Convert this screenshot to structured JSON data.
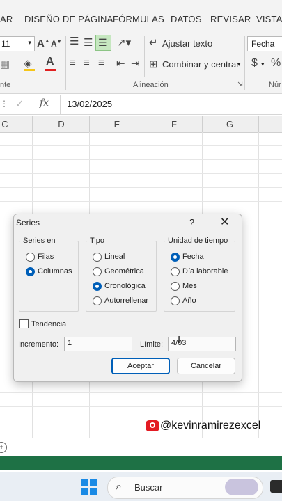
{
  "ribbon_tabs": [
    "AR",
    "DISEÑO DE PÁGINA",
    "FÓRMULAS",
    "DATOS",
    "REVISAR",
    "VISTA"
  ],
  "font_size": "11",
  "wrap_text": "Ajustar texto",
  "merge_center": "Combinar y centrar",
  "number_format": "Fecha",
  "group_font_label": "nte",
  "group_alignment_label": "Alineación",
  "group_number_label": "Núr",
  "formula_value": "13/02/2025",
  "fx_label": "fx",
  "columns": [
    "C",
    "D",
    "E",
    "F",
    "G"
  ],
  "dialog": {
    "title": "Series",
    "help": "?",
    "series_en": {
      "title": "Series en",
      "options": [
        "Filas",
        "Columnas"
      ],
      "selected": 1
    },
    "tipo": {
      "title": "Tipo",
      "options": [
        "Lineal",
        "Geométrica",
        "Cronológica",
        "Autorrellenar"
      ],
      "selected": 2
    },
    "unidad": {
      "title": "Unidad de tiempo",
      "options": [
        "Fecha",
        "Día laborable",
        "Mes",
        "Año"
      ],
      "selected": 0
    },
    "tendencia": "Tendencia",
    "incremento_label": "Incremento:",
    "incremento_value": "1",
    "limite_label": "Límite:",
    "limite_value": "4/03",
    "accept": "Aceptar",
    "cancel": "Cancelar"
  },
  "watermark": "@kevinramirezexcel",
  "taskbar_search": "Buscar"
}
